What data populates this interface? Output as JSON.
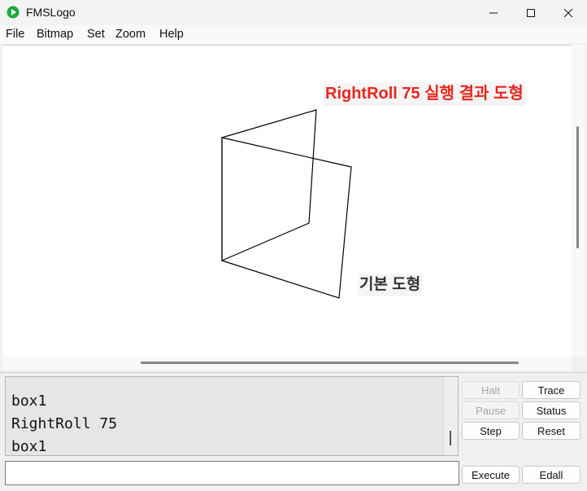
{
  "window": {
    "title": "FMSLogo"
  },
  "menu": {
    "items": [
      "File",
      "Bitmap",
      "Set",
      "Zoom",
      "Help"
    ]
  },
  "canvas": {
    "label_result": "RightRoll 75 실행 결과 도형",
    "label_base": "기본 도형",
    "colors": {
      "label_result": "#e8271f",
      "label_base": "#333333",
      "lines": "#000000"
    }
  },
  "commander": {
    "history": [
      "box1",
      "RightRoll 75",
      "box1"
    ],
    "input_value": "",
    "buttons": {
      "halt": "Halt",
      "trace": "Trace",
      "pause": "Pause",
      "status": "Status",
      "step": "Step",
      "reset": "Reset",
      "execute": "Execute",
      "edall": "Edall"
    }
  }
}
